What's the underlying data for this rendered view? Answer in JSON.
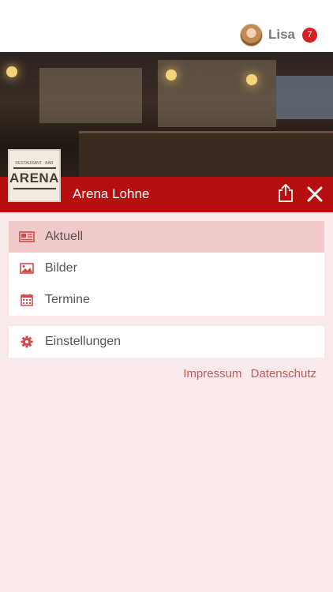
{
  "header": {
    "user_name": "Lisa",
    "notification_count": "7"
  },
  "venue": {
    "name": "Arena Lohne",
    "logo_text": "ARENA",
    "logo_sub": "RESTAURANT · BAR"
  },
  "menu": {
    "items": [
      {
        "label": "Aktuell",
        "icon": "newspaper-icon",
        "active": true
      },
      {
        "label": "Bilder",
        "icon": "image-icon",
        "active": false
      },
      {
        "label": "Termine",
        "icon": "calendar-icon",
        "active": false
      }
    ],
    "settings_label": "Einstellungen"
  },
  "footer": {
    "impressum": "Impressum",
    "datenschutz": "Datenschutz"
  },
  "colors": {
    "brand_red": "#b70e10",
    "accent_icon": "#d04a4a",
    "background": "#f8eaea",
    "active_item": "#f0caca"
  }
}
